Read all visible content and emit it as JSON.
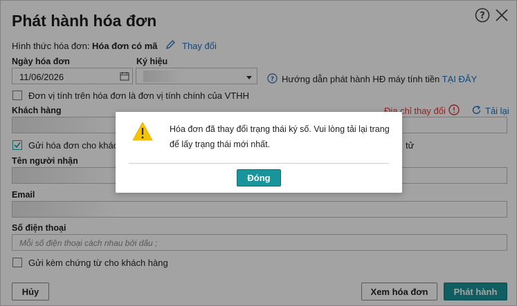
{
  "header": {
    "title": "Phát hành hóa đơn"
  },
  "invoice_type": {
    "label": "Hình thức hóa đơn:",
    "value": "Hóa đơn có mã",
    "change_link": "Thay đổi"
  },
  "date": {
    "label": "Ngày hóa đơn",
    "value": "11/06/2026"
  },
  "symbol": {
    "label": "Ký hiệu"
  },
  "help": {
    "text": "Hướng dẫn phát hành HĐ máy tính tiền",
    "link": "TẠI ĐÂY"
  },
  "unit_checkbox": {
    "label": "Đơn vị tính trên hóa đơn là đơn vị tính chính của VTHH",
    "checked": false
  },
  "customer": {
    "label": "Khách hàng",
    "address_changed": "Địa chỉ thay đổi",
    "reload": "Tải lại"
  },
  "send_checkbox": {
    "label": "Gửi hóa đơn cho khách",
    "label_tail": "tử",
    "checked": true
  },
  "recipient": {
    "label": "Tên người nhận"
  },
  "email": {
    "label": "Email"
  },
  "phone": {
    "label": "Số điện thoại",
    "placeholder": "Mỗi số điện thoại cách nhau bởi dấu ;"
  },
  "attach_checkbox": {
    "label": "Gửi kèm chứng từ cho khách hàng",
    "checked": false
  },
  "footer": {
    "cancel": "Hủy",
    "view": "Xem hóa đơn",
    "issue": "Phát hành"
  },
  "alert": {
    "line1": "Hóa đơn đã thay đổi trạng thái ký số. Vui lòng tải lại trang",
    "line2": "để lấy trạng thái mới nhất.",
    "ok": "Đóng"
  },
  "colors": {
    "accent": "#18949a",
    "link": "#1f6fb8",
    "error": "#d63a3a",
    "warning": "#f5c400"
  }
}
